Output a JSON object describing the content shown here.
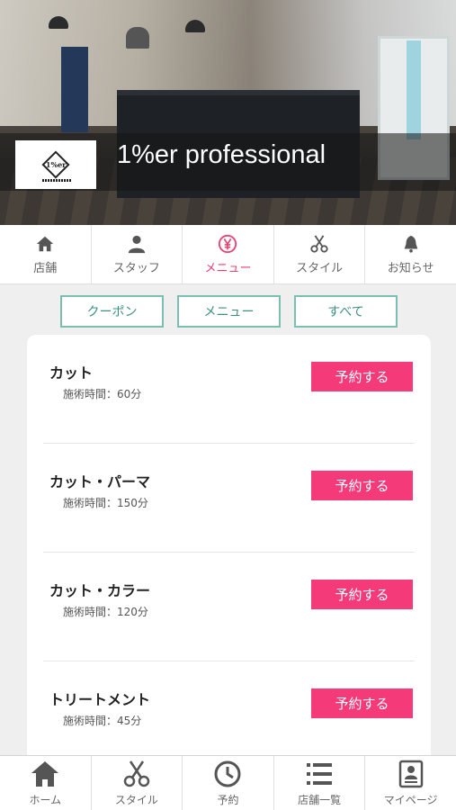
{
  "shop": {
    "name": "1%er professional",
    "logo_text": "1%er"
  },
  "top_tabs": [
    {
      "label": "店舗",
      "icon": "home-icon"
    },
    {
      "label": "スタッフ",
      "icon": "person-icon"
    },
    {
      "label": "メニュー",
      "icon": "yen-icon",
      "active": true
    },
    {
      "label": "スタイル",
      "icon": "scissors-icon"
    },
    {
      "label": "お知らせ",
      "icon": "bell-icon"
    }
  ],
  "filters": [
    {
      "label": "クーポン"
    },
    {
      "label": "メニュー"
    },
    {
      "label": "すべて"
    }
  ],
  "menu_items": [
    {
      "name": "カット",
      "duration": "施術時間：60分",
      "button": "予約する"
    },
    {
      "name": "カット・パーマ",
      "duration": "施術時間：150分",
      "button": "予約する"
    },
    {
      "name": "カット・カラー",
      "duration": "施術時間：120分",
      "button": "予約する"
    },
    {
      "name": "トリートメント",
      "duration": "施術時間：45分",
      "button": "予約する"
    }
  ],
  "bottom_tabs": [
    {
      "label": "ホーム",
      "icon": "home-icon"
    },
    {
      "label": "スタイル",
      "icon": "scissors-icon"
    },
    {
      "label": "予約",
      "icon": "clock-icon"
    },
    {
      "label": "店舗一覧",
      "icon": "list-icon"
    },
    {
      "label": "マイページ",
      "icon": "profile-card-icon"
    }
  ],
  "colors": {
    "accent": "#f43a78",
    "active_tab": "#e8416f",
    "filter_border": "#7bbfb4",
    "filter_text": "#3d8f82"
  }
}
